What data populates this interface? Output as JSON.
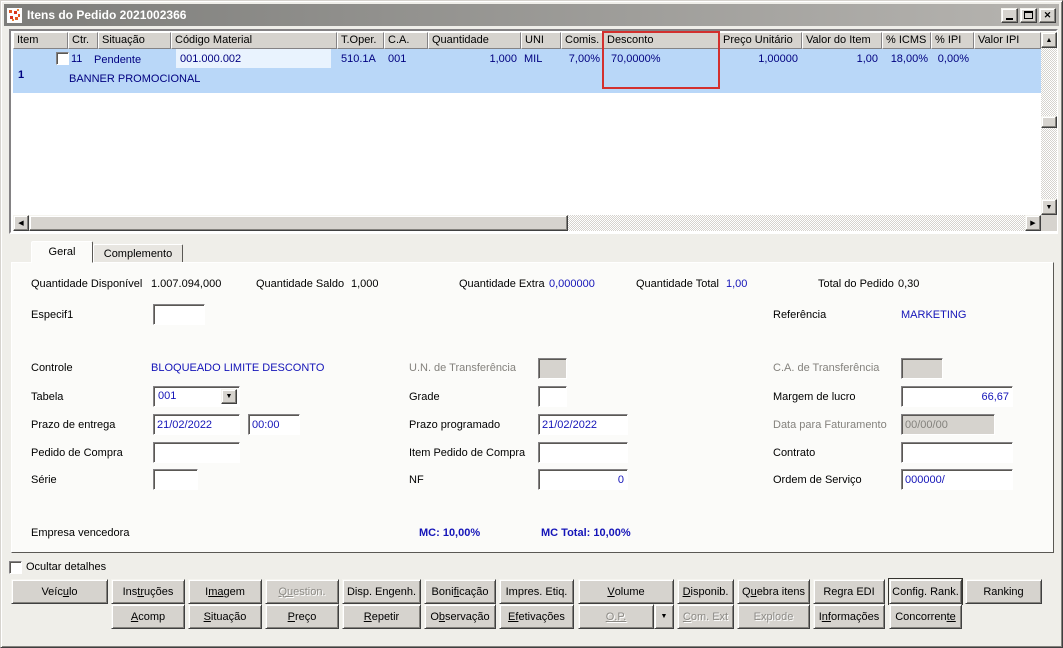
{
  "window": {
    "title": "Itens do Pedido 2021002366"
  },
  "colors": {
    "selection_row": "#b9d7f8",
    "annotation_red": "#d3302e",
    "grid_text_navy": "#000080",
    "form_value_blue": "#1414b8",
    "titlebar_gray": "#7d7d7a"
  },
  "grid": {
    "columns": [
      "Item",
      "Ctr.",
      "Situação",
      "Código Material",
      "T.Oper.",
      "C.A.",
      "Quantidade",
      "UNI",
      "Comis.",
      "Desconto",
      "Preço Unitário",
      "Valor do Item",
      "% ICMS",
      "% IPI",
      "Valor IPI"
    ],
    "row": {
      "item": "1",
      "checkbox_checked": false,
      "ctr": "11",
      "situacao": "Pendente",
      "codigo_material": "001.000.002",
      "descricao": "BANNER PROMOCIONAL",
      "t_oper": "510.1A",
      "ca": "001",
      "quantidade": "1,000",
      "uni": "MIL",
      "comis": "7,00%",
      "desconto": "70,0000%",
      "preco_unitario": "1,00000",
      "valor_item": "1,00",
      "icms": "18,00%",
      "ipi": "0,00%",
      "valor_ipi": ""
    }
  },
  "tabs": {
    "geral": "Geral",
    "complemento": "Complemento"
  },
  "geral": {
    "quantidade_disponivel": {
      "label": "Quantidade Disponível",
      "value": "1.007.094,000"
    },
    "quantidade_saldo": {
      "label": "Quantidade Saldo",
      "value": "1,000"
    },
    "quantidade_extra": {
      "label": "Quantidade Extra",
      "value": "0,000000"
    },
    "quantidade_total": {
      "label": "Quantidade Total",
      "value": "1,00"
    },
    "total_do_pedido": {
      "label": "Total do Pedido",
      "value": "0,30"
    },
    "especif1": {
      "label": "Especif1",
      "value": ""
    },
    "referencia": {
      "label": "Referência",
      "value": "MARKETING"
    },
    "controle": {
      "label": "Controle",
      "value": "BLOQUEADO LIMITE DESCONTO"
    },
    "un_transferencia": {
      "label": "U.N. de Transferência",
      "value": ""
    },
    "ca_transferencia": {
      "label": "C.A. de Transferência",
      "value": ""
    },
    "tabela": {
      "label": "Tabela",
      "value": "001"
    },
    "grade": {
      "label": "Grade",
      "value": ""
    },
    "margem_lucro": {
      "label": "Margem de lucro",
      "value": "66,67"
    },
    "prazo_entrega": {
      "label": "Prazo de entrega",
      "date": "21/02/2022",
      "time": "00:00"
    },
    "prazo_programado": {
      "label": "Prazo programado",
      "value": "21/02/2022"
    },
    "data_faturamento": {
      "label": "Data para Faturamento",
      "value": "00/00/00"
    },
    "pedido_compra": {
      "label": "Pedido de Compra",
      "value": ""
    },
    "item_pedido_compra": {
      "label": "Item Pedido de Compra",
      "value": ""
    },
    "contrato": {
      "label": "Contrato",
      "value": ""
    },
    "serie": {
      "label": "Série",
      "value": ""
    },
    "nf": {
      "label": "NF",
      "value": "0"
    },
    "ordem_servico": {
      "label": "Ordem de Serviço",
      "value": "000000/"
    },
    "empresa_vencedora": {
      "label": "Empresa vencedora"
    },
    "mc": "MC: 10,00%",
    "mc_total": "MC Total: 10,00%"
  },
  "footer": {
    "ocultar_detalhes": "Ocultar detalhes",
    "checked": false
  },
  "buttons": {
    "row1": [
      {
        "label": "Veículo",
        "accel": "u",
        "enabled": true
      },
      {
        "label": "Instruções",
        "accel": "tr",
        "enabled": true
      },
      {
        "label": "Imagem",
        "accel": "ma",
        "enabled": true
      },
      {
        "label": "Question.",
        "accel": "Qu",
        "enabled": false
      },
      {
        "label": "Disp. Engenh.",
        "accel": "",
        "enabled": true
      },
      {
        "label": "Bonificação",
        "accel": "fi",
        "enabled": true
      },
      {
        "label": "Impres. Etiq.",
        "accel": "",
        "enabled": true
      },
      {
        "label": "Volume",
        "accel": "V",
        "enabled": true
      },
      {
        "label": "Disponib.",
        "accel": "D",
        "enabled": true
      },
      {
        "label": "Quebra itens",
        "accel": "u",
        "enabled": true
      },
      {
        "label": "Regra EDI",
        "accel": "g",
        "enabled": true
      },
      {
        "label": "Config. Rank.",
        "accel": "",
        "enabled": true
      },
      {
        "label": "Ranking",
        "accel": "",
        "enabled": true
      }
    ],
    "row2": [
      {
        "label": "Acomp",
        "accel": "A",
        "enabled": true
      },
      {
        "label": "Situação",
        "accel": "S",
        "enabled": true
      },
      {
        "label": "Preço",
        "accel": "P",
        "enabled": true
      },
      {
        "label": "Repetir",
        "accel": "R",
        "enabled": true
      },
      {
        "label": "Observação",
        "accel": "b",
        "enabled": true
      },
      {
        "label": "Efetivações",
        "accel": "Ef",
        "enabled": true
      },
      {
        "label": "O.P.",
        "accel": "O.P.",
        "enabled": false
      },
      {
        "label": "Com. Ext",
        "accel": "C",
        "enabled": false
      },
      {
        "label": "Explode",
        "accel": "",
        "enabled": false
      },
      {
        "label": "Informações",
        "accel": "nf",
        "enabled": true
      },
      {
        "label": "Concorrente",
        "accel": "te",
        "enabled": true
      }
    ]
  }
}
